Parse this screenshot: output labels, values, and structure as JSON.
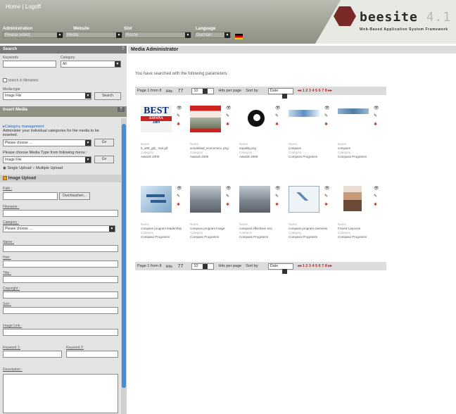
{
  "header": {
    "links": "Home | Logoff",
    "dropdowns": [
      {
        "label": "Administration",
        "value": "Please select"
      },
      {
        "label": "Website",
        "value": "Media"
      },
      {
        "label": "Slot",
        "value": "Roche"
      },
      {
        "label": "Language",
        "value": "German"
      }
    ],
    "logo": {
      "name": "beesite",
      "version": "4.1",
      "tagline": "Web-Based Application System Framework"
    }
  },
  "search": {
    "title": "Search",
    "help": "?",
    "keywords_label": "Keywords",
    "category_label": "Category",
    "category_value": "All",
    "filenames_label": "search in filenames",
    "media_type_label": "Media type",
    "media_type_value": "Image File",
    "search_button": "Search"
  },
  "insert": {
    "title": "Insert Media",
    "help": "?",
    "category_mgmt": "Category management",
    "category_mgmt_desc": "Administer your individual categories for the media to be inserted.",
    "please_choose": "Please choose ...",
    "go": "Go",
    "media_type_prompt": "Please choose Media Type from following menu :",
    "media_type_value": "Image File",
    "single_upload": "Single Upload",
    "multiple_upload": "Multiple Upload",
    "image_upload": "Image Upload",
    "path_label": "Path :",
    "browse": "Durchsuchen...",
    "filename_label": "Filename :",
    "category_label": "Category :",
    "category_value": "Please choose ...",
    "name_label": "Name :",
    "hint_label": "Hint :",
    "title_label": "Title :",
    "copyright_label": "Copyright :",
    "sort_label": "Sort :",
    "image_link_label": "Image Link :",
    "keyword1_label": "Keyword 1:",
    "keyword2_label": "Keyword 2:",
    "description_label": "Description :"
  },
  "main": {
    "title": "Media Administrator",
    "params": "You have searched with the following parameters:",
    "pager": {
      "page": "Page 1 from 8",
      "hits_label": "Hits",
      "hits": "77",
      "per_page": "10",
      "per_page_label": "Hits per page",
      "sort_label": "Sort by",
      "sort_value": "Date",
      "nav": "◂◂ 1 2 3 4 5 6 7 8 ▸▸"
    },
    "name_key": "Name",
    "category_key": "Category",
    "items": [
      {
        "thumb": "best",
        "name": "b_a09_gib_ mid.gif",
        "category": "Awards 2009"
      },
      {
        "thumb": "magazine",
        "name": "actualidad_economica .png",
        "category": "Awards 2009"
      },
      {
        "thumb": "equality",
        "name": "equality.png",
        "category": "Awards 2009"
      },
      {
        "thumb": "banner",
        "name": "compass",
        "category": "Compass Programm"
      },
      {
        "thumb": "banner2",
        "name": "compass",
        "category": "Compass Programm"
      },
      {
        "thumb": "chart",
        "name": "compass program leadership",
        "category": "Compass Programm"
      },
      {
        "thumb": "people",
        "name": "compass program image",
        "category": "Compass Programm"
      },
      {
        "thumb": "people",
        "name": "compass effectiven ess",
        "category": "Compass Programm"
      },
      {
        "thumb": "slide",
        "name": "compass program overview",
        "category": "Compass Programm"
      },
      {
        "thumb": "portrait",
        "name": "Franck Lepouze",
        "category": "Compass Programm"
      }
    ]
  },
  "colors": {
    "header": "#9fa395",
    "section": "#77797a",
    "panel": "#e4e4e4",
    "scroll": "#4a8cd0",
    "logo_hex": "#7a2a26"
  }
}
